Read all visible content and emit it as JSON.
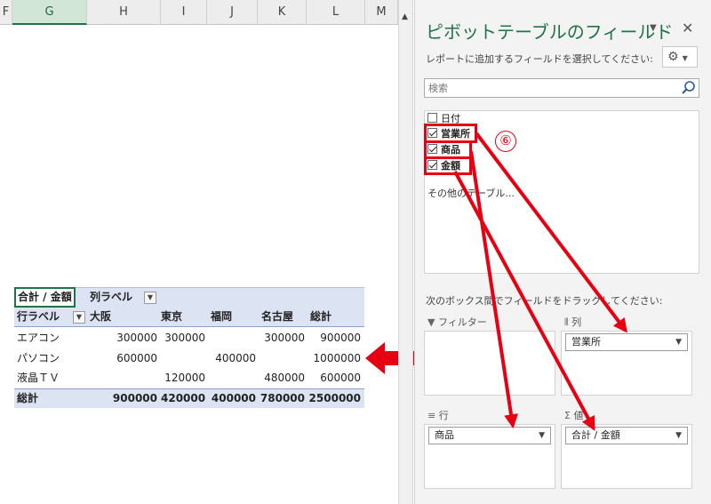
{
  "columns": [
    "F",
    "G",
    "H",
    "I",
    "J",
    "K",
    "L",
    "M"
  ],
  "selected_column": "G",
  "pivot": {
    "a1": "合計 / 金額",
    "col_label": "列ラベル",
    "row_label": "行ラベル",
    "col_headers": [
      "大阪",
      "東京",
      "福岡",
      "名古屋",
      "総計"
    ],
    "rows": [
      {
        "label": "エアコン",
        "values": [
          "300000",
          "300000",
          "",
          "300000",
          "900000"
        ]
      },
      {
        "label": "パソコン",
        "values": [
          "600000",
          "",
          "400000",
          "",
          "1000000"
        ]
      },
      {
        "label": "液晶ＴＶ",
        "values": [
          "",
          "120000",
          "",
          "480000",
          "600000"
        ]
      }
    ],
    "total": {
      "label": "総計",
      "values": [
        "900000",
        "420000",
        "400000",
        "780000",
        "2500000"
      ]
    }
  },
  "pane": {
    "title": "ピボットテーブルのフィールド",
    "subtitle": "レポートに追加するフィールドを選択してください:",
    "search_placeholder": "検索",
    "fields": [
      {
        "label": "日付",
        "checked": false
      },
      {
        "label": "営業所",
        "checked": true
      },
      {
        "label": "商品",
        "checked": true
      },
      {
        "label": "金額",
        "checked": true
      }
    ],
    "more_tables": "その他のテーブル...",
    "drag_hint": "次のボックス間でフィールドをドラッグしてください:",
    "areas": {
      "filter": {
        "label": "フィルター",
        "chip": ""
      },
      "columns": {
        "label": "列",
        "chip": "営業所"
      },
      "rows": {
        "label": "行",
        "chip": "商品"
      },
      "values": {
        "label": "値",
        "chip": "合計 / 金額"
      }
    }
  },
  "annotation": {
    "step": "⑥",
    "color": "#e60012"
  },
  "colors": {
    "accent": "#217346",
    "pivot_header": "#dce3f2",
    "annotation_red": "#e60012"
  }
}
